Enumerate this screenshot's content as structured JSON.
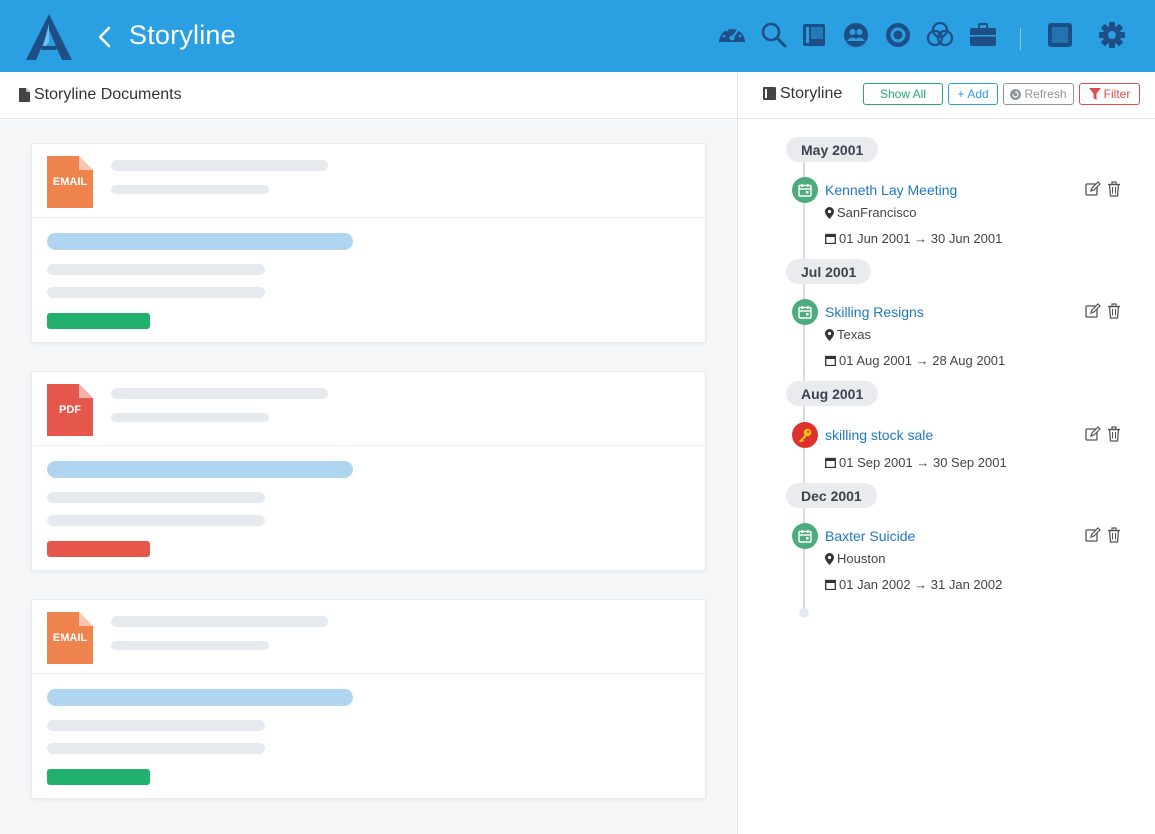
{
  "header": {
    "title": "Storyline",
    "nav_icons": [
      "dashboard-icon",
      "search-icon",
      "book-icon",
      "users-icon",
      "target-icon",
      "venn-icon",
      "briefcase-icon",
      "panel-icon",
      "gear-icon"
    ]
  },
  "documents_panel": {
    "title": "Storyline Documents",
    "cards": [
      {
        "type_label": "EMAIL",
        "type_color": "#ee834e",
        "tag_color": "#22b16c"
      },
      {
        "type_label": "PDF",
        "type_color": "#e5574b",
        "tag_color": "#e5574b"
      },
      {
        "type_label": "EMAIL",
        "type_color": "#ee834e",
        "tag_color": "#22b16c"
      }
    ]
  },
  "storyline_panel": {
    "title": "Storyline",
    "buttons": {
      "show_all": "Show All",
      "add": "Add",
      "refresh": "Refresh",
      "filter": "Filter"
    },
    "groups": [
      {
        "month": "May 2001",
        "events": [
          {
            "title": "Kenneth Lay Meeting",
            "location": "SanFrancisco",
            "dates": "01 Jun 2001 → 30 Jun 2001",
            "icon": "calendar-icon",
            "icon_color": "#4dab7c"
          }
        ]
      },
      {
        "month": "Jul 2001",
        "events": [
          {
            "title": "Skilling Resigns",
            "location": "Texas",
            "dates": "01 Aug 2001 → 28 Aug 2001",
            "icon": "calendar-icon",
            "icon_color": "#4dab7c"
          }
        ]
      },
      {
        "month": "Aug 2001",
        "events": [
          {
            "title": "skilling stock sale",
            "location": "",
            "dates": "01 Sep 2001 → 30 Sep 2001",
            "icon": "key-icon",
            "icon_color": "#e0322c"
          }
        ]
      },
      {
        "month": "Dec 2001",
        "events": [
          {
            "title": "Baxter Suicide",
            "location": "Houston",
            "dates": "01 Jan 2002 → 31 Jan 2002",
            "icon": "calendar-icon",
            "icon_color": "#4dab7c"
          }
        ]
      }
    ]
  },
  "colors": {
    "header_bg": "#2a9fe2",
    "link": "#1e78c2",
    "nav_icon": "#1d4f86"
  }
}
